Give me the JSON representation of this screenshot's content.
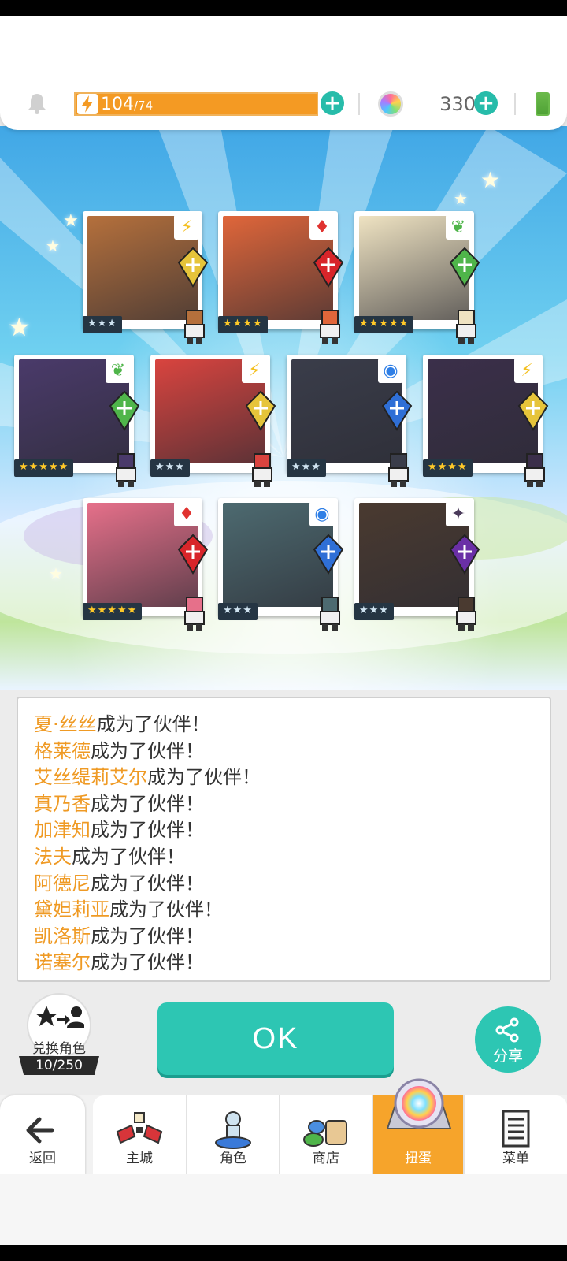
{
  "topbar": {
    "energy_current": "104",
    "energy_max": "/74",
    "gem_count": "330",
    "energy_fill_fraction": 1.0
  },
  "cards": [
    {
      "stars": "★★★",
      "tier": "silver",
      "element": "lightning",
      "element_icon": "⚡",
      "portrait_color": "#b5703c",
      "new": false
    },
    {
      "stars": "★★★★",
      "tier": "gold",
      "element": "fire",
      "element_icon": "♦",
      "portrait_color": "#e0663a",
      "new": false
    },
    {
      "stars": "★★★★★",
      "tier": "gold",
      "element": "earth",
      "element_icon": "❦",
      "portrait_color": "#efe3c2",
      "new": true
    },
    {
      "stars": "★★★★★",
      "tier": "gold",
      "element": "earth",
      "element_icon": "❦",
      "portrait_color": "#4a3a6a",
      "new": true
    },
    {
      "stars": "★★★",
      "tier": "silver",
      "element": "lightning",
      "element_icon": "⚡",
      "portrait_color": "#d9443f",
      "new": false
    },
    {
      "stars": "★★★",
      "tier": "silver",
      "element": "water",
      "element_icon": "◉",
      "portrait_color": "#3a3d4a",
      "new": false
    },
    {
      "stars": "★★★★",
      "tier": "gold",
      "element": "lightning",
      "element_icon": "⚡",
      "portrait_color": "#3b2f4a",
      "new": false
    },
    {
      "stars": "★★★★★",
      "tier": "gold",
      "element": "fire",
      "element_icon": "♦",
      "portrait_color": "#e6708a",
      "new": true
    },
    {
      "stars": "★★★",
      "tier": "silver",
      "element": "water",
      "element_icon": "◉",
      "portrait_color": "#4d6a70",
      "new": false
    },
    {
      "stars": "★★★",
      "tier": "silver",
      "element": "dark",
      "element_icon": "✦",
      "portrait_color": "#4a3a30",
      "new": false
    }
  ],
  "log": {
    "suffix": "成为了伙伴！",
    "names": [
      "夏·丝丝",
      "格莱德",
      "艾丝缇莉艾尔",
      "真乃香",
      "加津知",
      "法夫",
      "阿德尼",
      "黛妲莉亚",
      "凯洛斯",
      "诺塞尔"
    ]
  },
  "exchange": {
    "label": "兑换角色",
    "count": "10/250"
  },
  "ok_label": "OK",
  "share_label": "分享",
  "nav": [
    {
      "label": "返回",
      "icon": "back-arrow-icon"
    },
    {
      "label": "主城",
      "icon": "castle-icon"
    },
    {
      "label": "角色",
      "icon": "character-icon"
    },
    {
      "label": "商店",
      "icon": "shop-icon"
    },
    {
      "label": "扭蛋",
      "icon": "gacha-icon",
      "active": true
    },
    {
      "label": "菜单",
      "icon": "menu-icon"
    }
  ],
  "colors": {
    "accent_teal": "#2dc6b3",
    "energy_orange": "#f49a23",
    "name_orange": "#ef9a24",
    "active_tab": "#f6a42b"
  }
}
